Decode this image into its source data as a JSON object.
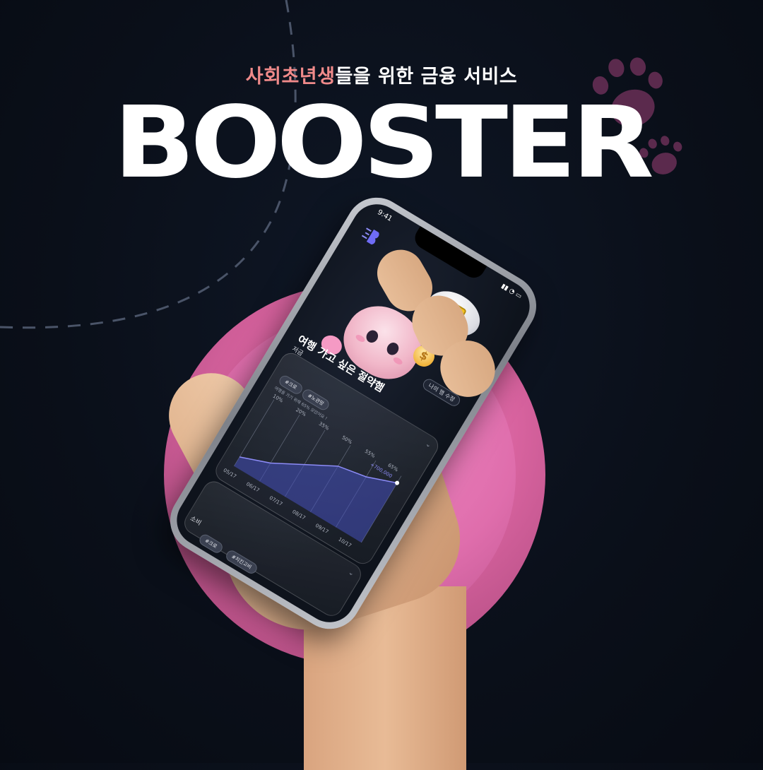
{
  "header": {
    "tagline_highlight": "사회초년생",
    "tagline_rest": "들을 위한 금융 서비스",
    "brand": "BOOSTER"
  },
  "phone": {
    "status_time": "9:41",
    "edit_chip": "나의 햄 수정",
    "title": "여행 가고 싶은 절약햄",
    "saving": {
      "section_label": "저금",
      "chips": [
        "#크로",
        "#노관망"
      ],
      "note": "여행을 가기 위해 65% 모았어요 !",
      "percents": [
        "10%",
        "20%",
        "35%",
        "50%",
        "55%",
        "65%"
      ],
      "dates": [
        "05/17",
        "06/17",
        "07/17",
        "08/17",
        "09/17",
        "10/17"
      ],
      "reward": "+700,000"
    },
    "spending": {
      "section_label": "소비",
      "chips": [
        "#크로",
        "#치킨고비"
      ]
    }
  },
  "chart_data": {
    "type": "area",
    "x": [
      "05/17",
      "06/17",
      "07/17",
      "08/17",
      "09/17",
      "10/17"
    ],
    "y": [
      10,
      20,
      35,
      50,
      55,
      65
    ],
    "ylabel": "",
    "xlabel": "",
    "title": "",
    "annotation": "+700,000"
  },
  "colors": {
    "highlight": "#f08a8a",
    "circle": "#d8639f",
    "chart_line": "#8c8bf6"
  }
}
